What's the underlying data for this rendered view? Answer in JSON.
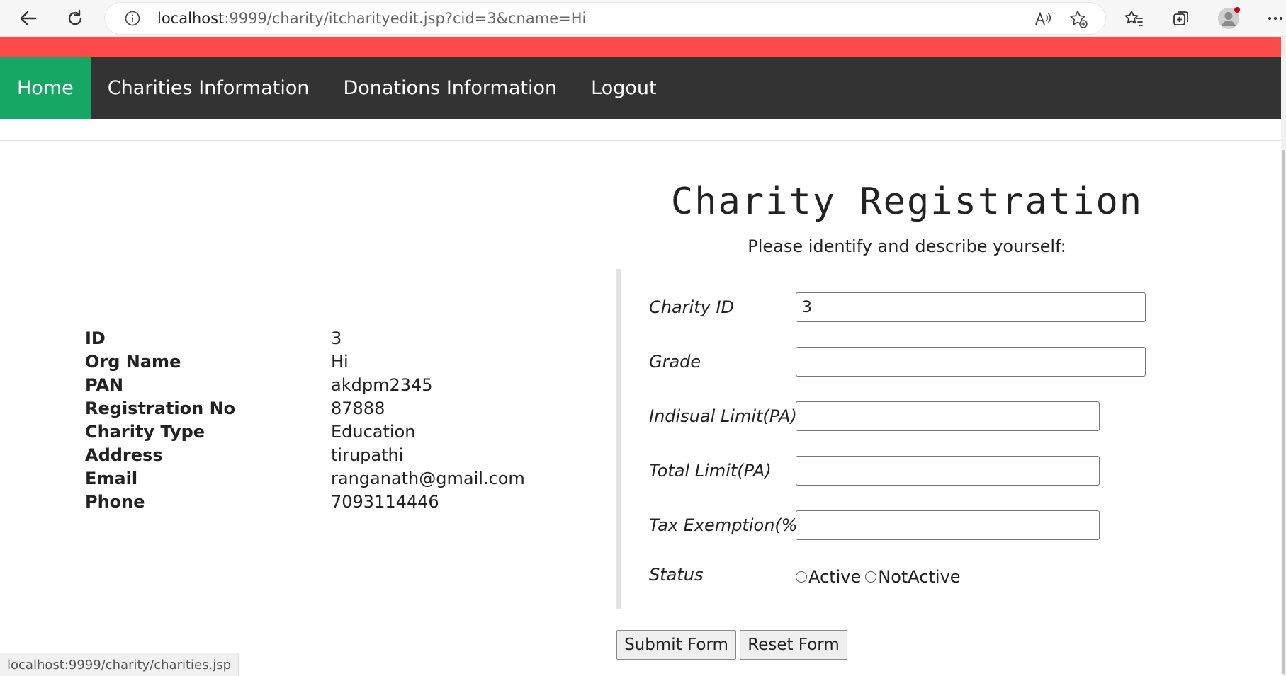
{
  "browser": {
    "url_host": "localhost",
    "url_path": ":9999/charity/itcharityedit.jsp?cid=3&cname=Hi",
    "icons": {
      "back": "back-arrow-icon",
      "refresh": "refresh-icon",
      "info": "info-icon",
      "read_aloud": "read-aloud-icon",
      "add_favorite": "add-favorite-icon",
      "favorites": "favorites-icon",
      "collections": "collections-icon",
      "profile": "profile-avatar-icon"
    }
  },
  "nav": {
    "items": [
      {
        "label": "Home",
        "active": true
      },
      {
        "label": "Charities Information",
        "active": false
      },
      {
        "label": "Donations Information",
        "active": false
      },
      {
        "label": "Logout",
        "active": false
      }
    ]
  },
  "details": {
    "rows": [
      {
        "label": "ID",
        "value": "3"
      },
      {
        "label": "Org Name",
        "value": "Hi"
      },
      {
        "label": "PAN",
        "value": "akdpm2345"
      },
      {
        "label": "Registration No",
        "value": "87888"
      },
      {
        "label": "Charity Type",
        "value": "Education"
      },
      {
        "label": "Address",
        "value": "tirupathi"
      },
      {
        "label": "Email",
        "value": "ranganath@gmail.com"
      },
      {
        "label": "Phone",
        "value": "7093114446"
      }
    ]
  },
  "form": {
    "title": "Charity Registration",
    "subtitle": "Please identify and describe yourself:",
    "fields": [
      {
        "label": "Charity ID",
        "value": "3"
      },
      {
        "label": "Grade",
        "value": ""
      },
      {
        "label": "Indisual Limit(PA)",
        "value": ""
      },
      {
        "label": "Total Limit(PA)",
        "value": ""
      },
      {
        "label": "Tax Exemption(%)",
        "value": ""
      }
    ],
    "status_label": "Status",
    "status_options": [
      "Active",
      "NotActive"
    ],
    "submit_label": "Submit Form",
    "reset_label": "Reset Form"
  },
  "status_bar": {
    "text": "localhost:9999/charity/charities.jsp"
  },
  "colors": {
    "banner": "#ff4a4a",
    "navbar": "#333333",
    "nav_active": "#16a765"
  }
}
